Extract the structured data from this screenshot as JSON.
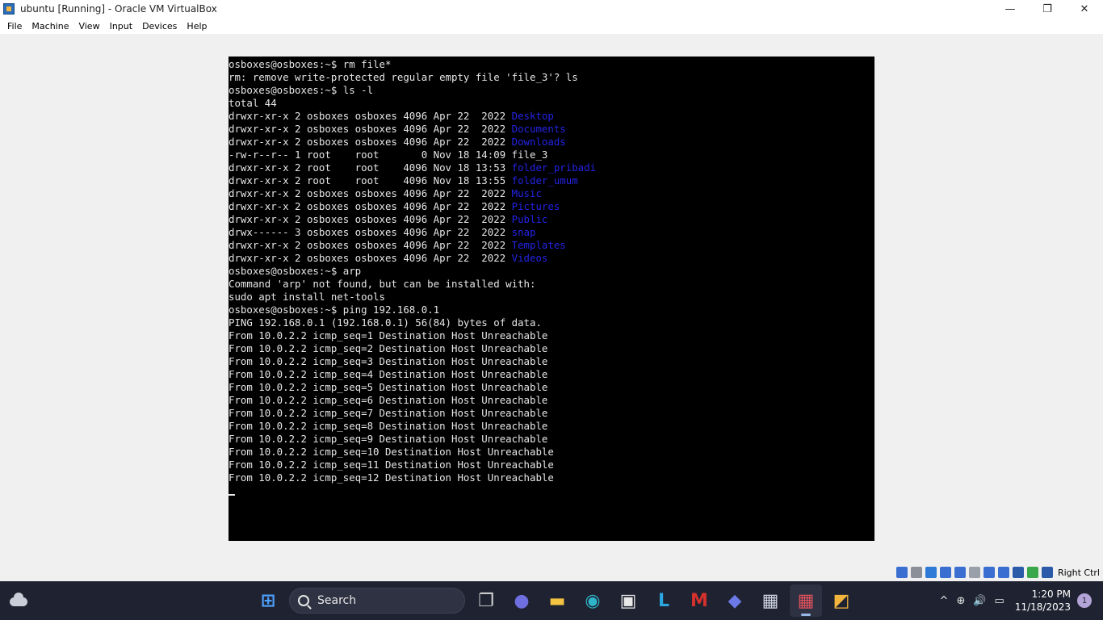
{
  "window": {
    "title": "ubuntu [Running] - Oracle VM VirtualBox",
    "minimize": "—",
    "maximize": "❐",
    "close": "✕"
  },
  "menu": [
    "File",
    "Machine",
    "View",
    "Input",
    "Devices",
    "Help"
  ],
  "terminal": {
    "lines": [
      [
        {
          "t": "osboxes@osboxes:~$ rm file*"
        }
      ],
      [
        {
          "t": "rm: remove write-protected regular empty file 'file_3'? ls"
        }
      ],
      [
        {
          "t": "osboxes@osboxes:~$ ls -l"
        }
      ],
      [
        {
          "t": "total 44"
        }
      ],
      [
        {
          "t": "drwxr-xr-x 2 osboxes osboxes 4096 Apr 22  2022 "
        },
        {
          "t": "Desktop",
          "dir": true
        }
      ],
      [
        {
          "t": "drwxr-xr-x 2 osboxes osboxes 4096 Apr 22  2022 "
        },
        {
          "t": "Documents",
          "dir": true
        }
      ],
      [
        {
          "t": "drwxr-xr-x 2 osboxes osboxes 4096 Apr 22  2022 "
        },
        {
          "t": "Downloads",
          "dir": true
        }
      ],
      [
        {
          "t": "-rw-r--r-- 1 root    root       0 Nov 18 14:09 file_3"
        }
      ],
      [
        {
          "t": "drwxr-xr-x 2 root    root    4096 Nov 18 13:53 "
        },
        {
          "t": "folder_pribadi",
          "dir": true
        }
      ],
      [
        {
          "t": "drwxr-xr-x 2 root    root    4096 Nov 18 13:55 "
        },
        {
          "t": "folder_umum",
          "dir": true
        }
      ],
      [
        {
          "t": "drwxr-xr-x 2 osboxes osboxes 4096 Apr 22  2022 "
        },
        {
          "t": "Music",
          "dir": true
        }
      ],
      [
        {
          "t": "drwxr-xr-x 2 osboxes osboxes 4096 Apr 22  2022 "
        },
        {
          "t": "Pictures",
          "dir": true
        }
      ],
      [
        {
          "t": "drwxr-xr-x 2 osboxes osboxes 4096 Apr 22  2022 "
        },
        {
          "t": "Public",
          "dir": true
        }
      ],
      [
        {
          "t": "drwx------ 3 osboxes osboxes 4096 Apr 22  2022 "
        },
        {
          "t": "snap",
          "dir": true
        }
      ],
      [
        {
          "t": "drwxr-xr-x 2 osboxes osboxes 4096 Apr 22  2022 "
        },
        {
          "t": "Templates",
          "dir": true
        }
      ],
      [
        {
          "t": "drwxr-xr-x 2 osboxes osboxes 4096 Apr 22  2022 "
        },
        {
          "t": "Videos",
          "dir": true
        }
      ],
      [
        {
          "t": "osboxes@osboxes:~$ arp"
        }
      ],
      [
        {
          "t": "Command 'arp' not found, but can be installed with:"
        }
      ],
      [
        {
          "t": "sudo apt install net-tools"
        }
      ],
      [
        {
          "t": "osboxes@osboxes:~$ ping 192.168.0.1"
        }
      ],
      [
        {
          "t": "PING 192.168.0.1 (192.168.0.1) 56(84) bytes of data."
        }
      ],
      [
        {
          "t": "From 10.0.2.2 icmp_seq=1 Destination Host Unreachable"
        }
      ],
      [
        {
          "t": "From 10.0.2.2 icmp_seq=2 Destination Host Unreachable"
        }
      ],
      [
        {
          "t": "From 10.0.2.2 icmp_seq=3 Destination Host Unreachable"
        }
      ],
      [
        {
          "t": "From 10.0.2.2 icmp_seq=4 Destination Host Unreachable"
        }
      ],
      [
        {
          "t": "From 10.0.2.2 icmp_seq=5 Destination Host Unreachable"
        }
      ],
      [
        {
          "t": "From 10.0.2.2 icmp_seq=6 Destination Host Unreachable"
        }
      ],
      [
        {
          "t": "From 10.0.2.2 icmp_seq=7 Destination Host Unreachable"
        }
      ],
      [
        {
          "t": "From 10.0.2.2 icmp_seq=8 Destination Host Unreachable"
        }
      ],
      [
        {
          "t": "From 10.0.2.2 icmp_seq=9 Destination Host Unreachable"
        }
      ],
      [
        {
          "t": "From 10.0.2.2 icmp_seq=10 Destination Host Unreachable"
        }
      ],
      [
        {
          "t": "From 10.0.2.2 icmp_seq=11 Destination Host Unreachable"
        }
      ],
      [
        {
          "t": "From 10.0.2.2 icmp_seq=12 Destination Host Unreachable"
        }
      ]
    ],
    "colors": {
      "background": "#000000",
      "text": "#e6e6e6",
      "directory": "#2323e8"
    }
  },
  "statusbar": {
    "icons": [
      {
        "name": "optical-drive-icon",
        "color": "#3a6fd1"
      },
      {
        "name": "disk-icon",
        "color": "#8a8f98"
      },
      {
        "name": "audio-icon",
        "color": "#2f7ad6"
      },
      {
        "name": "network-icon",
        "color": "#3a6fd1"
      },
      {
        "name": "usb-icon",
        "color": "#3a6fd1"
      },
      {
        "name": "shared-folders-icon",
        "color": "#9aa0aa"
      },
      {
        "name": "display-icon",
        "color": "#3a6fd1"
      },
      {
        "name": "recording-icon",
        "color": "#3a6fd1"
      },
      {
        "name": "virtualization-icon",
        "color": "#2a5aa8"
      },
      {
        "name": "mouse-integration-icon",
        "color": "#3aa84a"
      },
      {
        "name": "keyboard-capture-icon",
        "color": "#2a5aa8"
      }
    ],
    "host_key": "Right Ctrl"
  },
  "taskbar": {
    "search_label": "Search",
    "apps": [
      {
        "name": "start-icon",
        "glyph": "⊞",
        "color": "#4ea2ff"
      },
      {
        "name": "task-view-icon",
        "glyph": "❐",
        "color": "#d8d8d8"
      },
      {
        "name": "meet-icon",
        "glyph": "●",
        "color": "#6f6fe0"
      },
      {
        "name": "file-explorer-icon",
        "glyph": "▬",
        "color": "#f5c342"
      },
      {
        "name": "edge-icon",
        "glyph": "◉",
        "color": "#2fb3c9"
      },
      {
        "name": "store-icon",
        "glyph": "▣",
        "color": "#e8e8e8"
      },
      {
        "name": "l-app-icon",
        "glyph": "L",
        "color": "#2aa6e0"
      },
      {
        "name": "mcafee-icon",
        "glyph": "M",
        "color": "#d5312d"
      },
      {
        "name": "copilot-icon",
        "glyph": "◆",
        "color": "#6b7ae6"
      },
      {
        "name": "virtualbox-icon",
        "glyph": "▦",
        "color": "#cfd6e4"
      },
      {
        "name": "virtualbox-vm-icon",
        "glyph": "▦",
        "color": "#e0525e",
        "active": true
      },
      {
        "name": "app-icon",
        "glyph": "◩",
        "color": "#f3b53c"
      }
    ],
    "tray": {
      "chevron": "^",
      "globe": "⊕",
      "volume": "🔊",
      "battery": "▭",
      "time": "1:20 PM",
      "date": "11/18/2023",
      "notifications": "1"
    }
  }
}
